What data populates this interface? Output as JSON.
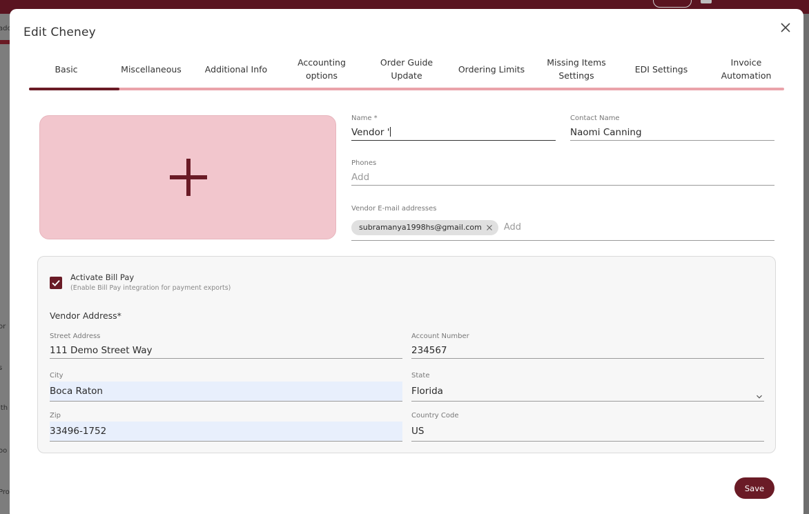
{
  "background": {
    "sidebar_fragments": [
      "ado",
      "or",
      "s",
      "lth",
      "oo",
      "Pro"
    ]
  },
  "modal": {
    "title": "Edit Cheney",
    "close_icon": "close-icon"
  },
  "tabs": [
    {
      "label": "Basic",
      "active": true
    },
    {
      "label": "Miscellaneous",
      "active": false
    },
    {
      "label": "Additional Info",
      "active": false
    },
    {
      "label": "Accounting options",
      "active": false
    },
    {
      "label": "Order Guide Update",
      "active": false
    },
    {
      "label": "Ordering Limits",
      "active": false
    },
    {
      "label": "Missing Items Settings",
      "active": false
    },
    {
      "label": "EDI Settings",
      "active": false
    },
    {
      "label": "Invoice Automation",
      "active": false
    }
  ],
  "dropzone": {
    "icon": "plus-icon"
  },
  "form": {
    "name": {
      "label": "Name *",
      "value": "Vendor '"
    },
    "contact_name": {
      "label": "Contact Name",
      "value": "Naomi Canning"
    },
    "phones": {
      "label": "Phones",
      "placeholder": "Add"
    },
    "emails": {
      "label": "Vendor E-mail addresses",
      "chips": [
        "subramanya1998hs@gmail.com"
      ],
      "placeholder": "Add"
    }
  },
  "bill_pay": {
    "checked": true,
    "title": "Activate Bill Pay",
    "subtitle": "(Enable Bill Pay integration for payment exports)"
  },
  "address": {
    "heading": "Vendor Address*",
    "street": {
      "label": "Street Address",
      "value": "111 Demo Street Way"
    },
    "account_number": {
      "label": "Account Number",
      "value": "234567"
    },
    "city": {
      "label": "City",
      "value": "Boca Raton"
    },
    "state": {
      "label": "State",
      "value": "Florida"
    },
    "zip": {
      "label": "Zip",
      "value": "33496-1752"
    },
    "country_code": {
      "label": "Country Code",
      "value": "US"
    }
  },
  "actions": {
    "save_label": "Save"
  },
  "colors": {
    "brand": "#6a1b26",
    "tab_track": "#eaa3aa",
    "dropzone": "#f2c6cd",
    "autofill": "#e8effc"
  }
}
